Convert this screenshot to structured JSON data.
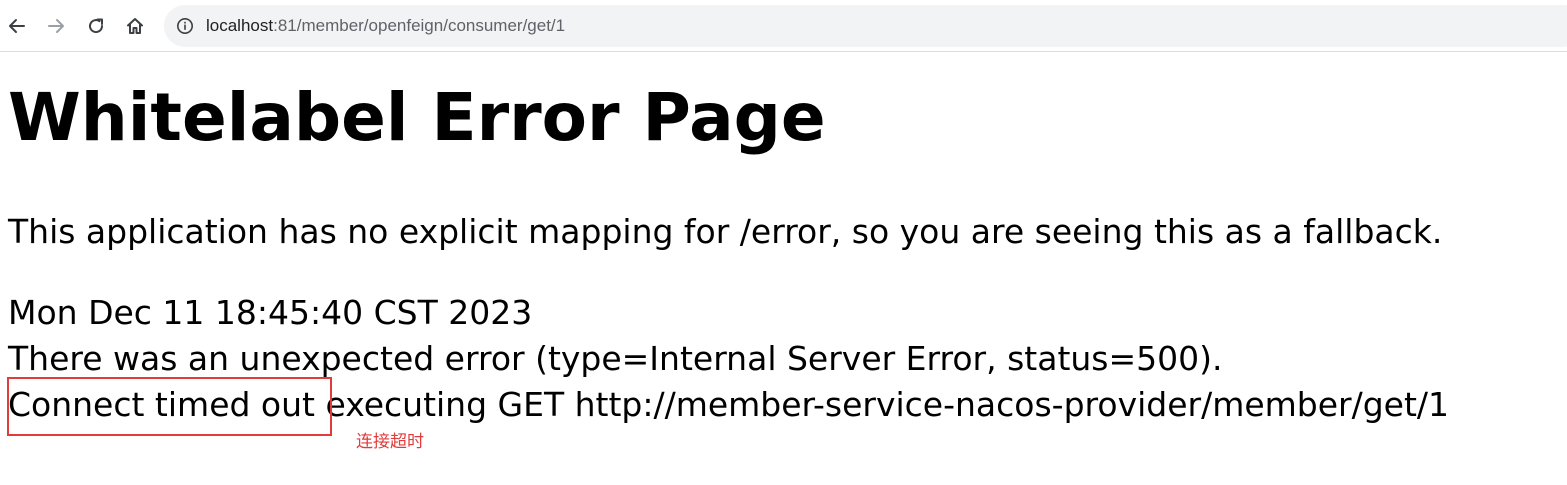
{
  "browser": {
    "icons": {
      "back": "arrow-left-icon",
      "forward": "arrow-right-icon",
      "reload": "reload-icon",
      "home": "home-icon",
      "site_info": "info-circle-icon"
    },
    "url_host": "localhost",
    "url_rest": ":81/member/openfeign/consumer/get/1"
  },
  "page": {
    "title": "Whitelabel Error Page",
    "description": "This application has no explicit mapping for /error, so you are seeing this as a fallback.",
    "timestamp": "Mon Dec 11 18:45:40 CST 2023",
    "error_line": "There was an unexpected error (type=Internal Server Error, status=500).",
    "message_highlight": "Connect timed out",
    "message_rest": " executing GET http://member-service-nacos-provider/member/get/1"
  },
  "annotation": {
    "text": "连接超时",
    "color": "#e03c3c"
  }
}
